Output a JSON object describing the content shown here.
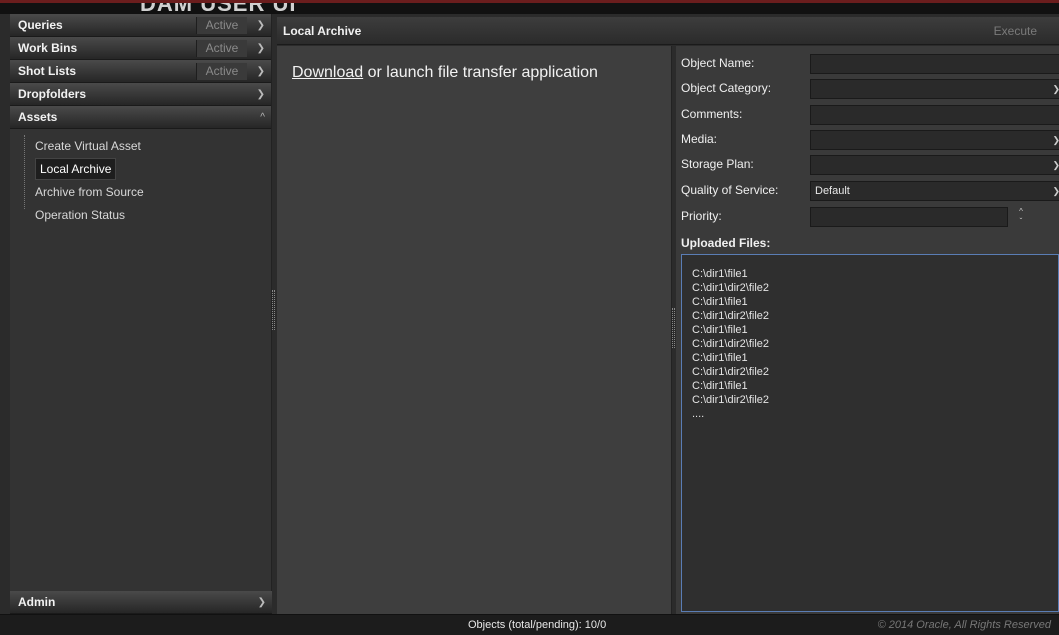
{
  "header": {
    "title": "DAM USER UI"
  },
  "sidebar": {
    "sections": [
      {
        "label": "Queries",
        "badge": "Active"
      },
      {
        "label": "Work Bins",
        "badge": "Active"
      },
      {
        "label": "Shot Lists",
        "badge": "Active"
      },
      {
        "label": "Dropfolders"
      },
      {
        "label": "Assets"
      }
    ],
    "assets_items": [
      {
        "label": "Create Virtual Asset"
      },
      {
        "label": "Local Archive",
        "selected": true
      },
      {
        "label": "Archive from Source"
      },
      {
        "label": "Operation Status"
      }
    ],
    "admin_label": "Admin"
  },
  "main": {
    "title": "Local Archive",
    "execute_label": "Execute",
    "download_link": "Download",
    "download_text": " or launch file transfer application"
  },
  "form": {
    "object_name_label": "Object Name:",
    "object_name_value": "",
    "object_category_label": "Object Category:",
    "object_category_value": "",
    "comments_label": "Comments:",
    "comments_value": "",
    "media_label": "Media:",
    "media_value": "",
    "storage_plan_label": "Storage Plan:",
    "storage_plan_value": "",
    "qos_label": "Quality of Service:",
    "qos_value": "Default",
    "priority_label": "Priority:",
    "priority_value": "",
    "uploaded_files_label": "Uploaded Files:",
    "uploaded_files": [
      "C:\\dir1\\file1",
      "C:\\dir1\\dir2\\file2",
      "C:\\dir1\\file1",
      "C:\\dir1\\dir2\\file2",
      "C:\\dir1\\file1",
      "C:\\dir1\\dir2\\file2",
      "C:\\dir1\\file1",
      "C:\\dir1\\dir2\\file2",
      "C:\\dir1\\file1",
      "C:\\dir1\\dir2\\file2",
      "...."
    ]
  },
  "status": {
    "objects": "Objects (total/pending): 10/0",
    "copyright": "© 2014 Oracle, All Rights Reserved"
  },
  "icons": {
    "chevron_down": "chevron-down-icon",
    "chevron_up": "chevron-up-icon",
    "spinner": "spinner-icon"
  }
}
